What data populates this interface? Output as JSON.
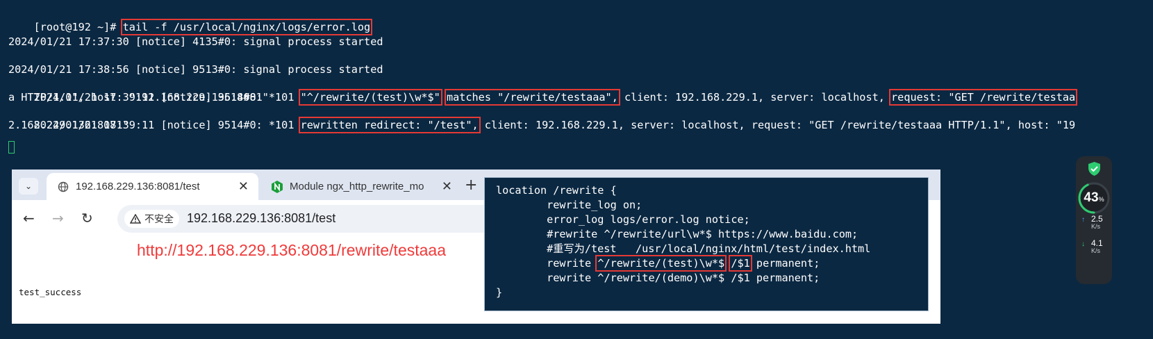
{
  "terminal": {
    "prompt": "[root@192 ~]# ",
    "command": "tail -f /usr/local/nginx/logs/error.log",
    "log1": "2024/01/21 17:37:30 [notice] 4135#0: signal process started",
    "log2": "2024/01/21 17:38:56 [notice] 9513#0: signal process started",
    "log3_prefix": "2024/01/21 17:39:11 [notice] 9514#0: *101 ",
    "log3_regex": "\"^/rewrite/(test)\\w*$\"",
    "log3_matches": "matches \"/rewrite/testaaa\",",
    "log3_mid": " client: 192.168.229.1, server: localhost, ",
    "log3_request": "request: \"GET /rewrite/testaa",
    "log3_cont": "a HTTP/1.1\", host: \"192.168.229.136:8081\"",
    "log4_prefix": "2024/01/21 17:39:11 [notice] 9514#0: *101 ",
    "log4_redirect": "rewritten redirect: \"/test\",",
    "log4_rest": " client: 192.168.229.1, server: localhost, request: \"GET /rewrite/testaaa HTTP/1.1\", host: \"19",
    "log4_cont": "2.168.229.136:8081\""
  },
  "browser": {
    "tabs": [
      {
        "title": "192.168.229.136:8081/test",
        "icon": "globe-icon"
      },
      {
        "title": "Module ngx_http_rewrite_mo",
        "icon": "nginx-icon"
      }
    ],
    "tab_close": "✕",
    "new_tab": "+",
    "insecure_label": "不安全",
    "url": "192.168.229.136:8081/test",
    "annotation": "http://192.168.229.136:8081/rewrite/testaaa",
    "page_text": "test_success"
  },
  "code": {
    "lines": [
      "location /rewrite {",
      "        rewrite_log on;",
      "        error_log logs/error.log notice;",
      "        #rewrite ^/rewrite/url\\w*$ https://www.baidu.com;",
      "        #重写为/test   /usr/local/nginx/html/test/index.html"
    ],
    "rewrite_prefix": "        rewrite ",
    "rewrite_regex": "^/rewrite/(test)\\w*$",
    "rewrite_target": "/$1",
    "rewrite_suffix": " permanent;",
    "line7": "        rewrite ^/rewrite/(demo)\\w*$ /$1 permanent;",
    "line8": "}"
  },
  "widget": {
    "cpu_percent": "43",
    "cpu_unit": "%",
    "cpu_fraction": 0.43,
    "upload_value": "2.5",
    "upload_unit": "K/s",
    "download_value": "4.1",
    "download_unit": "K/s"
  },
  "colors": {
    "terminal_bg": "#0b2842",
    "highlight": "#e53935",
    "annotation": "#f03a3a",
    "shield": "#2ecc71",
    "gauge": "#2ecc71"
  }
}
